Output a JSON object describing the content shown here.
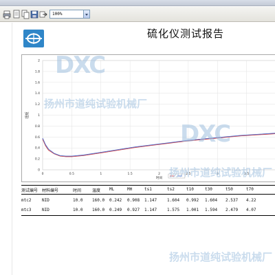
{
  "toolbar": {
    "zoom_value": "100%",
    "icons": [
      "print-icon",
      "page-setup-icon",
      "copy-icon",
      "save-icon",
      "export-icon"
    ]
  },
  "report": {
    "title": "硫化仪测试报告",
    "watermark_logo_text": "DXC",
    "watermark_company": "扬州市道纯试验机械厂",
    "colors": {
      "logo": "#2f86c8",
      "curve_red": "#d64545",
      "curve_blue": "#4a66c8",
      "watermark": "#9fc0e0"
    }
  },
  "chart_data": {
    "type": "line",
    "title": "",
    "xlabel": "时间",
    "ylabel": "扭矩",
    "xlim": [
      0,
      4
    ],
    "ylim": [
      0,
      2.0
    ],
    "x_ticks": [
      "0",
      "0.5",
      "1",
      "1.5",
      "2",
      "2.5",
      "3",
      "3.5"
    ],
    "y_ticks": [
      "0",
      "0.2",
      "0.4",
      "0.6",
      "0.8",
      "1",
      "1.2",
      "1.4",
      "1.6",
      "1.8",
      "2"
    ],
    "grid": true,
    "legend_position": "bottom-center",
    "series": [
      {
        "color": "#d64545",
        "x": [
          0,
          0.05,
          0.1,
          0.2,
          0.3,
          0.4,
          0.5,
          0.7,
          1.0,
          1.3,
          1.6,
          1.9,
          2.2,
          2.5,
          2.8,
          3.1,
          3.4,
          3.7,
          4.0
        ],
        "y": [
          0.56,
          0.44,
          0.36,
          0.29,
          0.25,
          0.24,
          0.24,
          0.26,
          0.31,
          0.36,
          0.41,
          0.45,
          0.49,
          0.53,
          0.56,
          0.59,
          0.62,
          0.64,
          0.66
        ]
      },
      {
        "color": "#4a66c8",
        "x": [
          0,
          0.05,
          0.1,
          0.2,
          0.3,
          0.4,
          0.5,
          0.7,
          1.0,
          1.3,
          1.6,
          1.9,
          2.2,
          2.5,
          2.8,
          3.1,
          3.4,
          3.7,
          4.0
        ],
        "y": [
          0.58,
          0.46,
          0.38,
          0.3,
          0.26,
          0.25,
          0.25,
          0.27,
          0.32,
          0.37,
          0.42,
          0.46,
          0.5,
          0.54,
          0.57,
          0.6,
          0.63,
          0.65,
          0.67
        ]
      }
    ]
  },
  "results_table": {
    "headers": [
      "测试编号",
      "材料编号",
      "时间",
      "温度",
      "ML",
      "MH",
      "ts1",
      "ts2",
      "t10",
      "t30",
      "t50",
      "t70"
    ],
    "rows": [
      [
        "mtc2",
        "NID",
        "10.0",
        "160.0",
        "0.242",
        "0.908",
        "1.147",
        "1.604",
        "0.992",
        "1.604",
        "2.537",
        "4.22"
      ],
      [
        "mtc3",
        "NID",
        "10.0",
        "160.0",
        "0.249",
        "0.927",
        "1.147",
        "1.575",
        "1.001",
        "1.594",
        "2.479",
        "4.07"
      ]
    ]
  }
}
